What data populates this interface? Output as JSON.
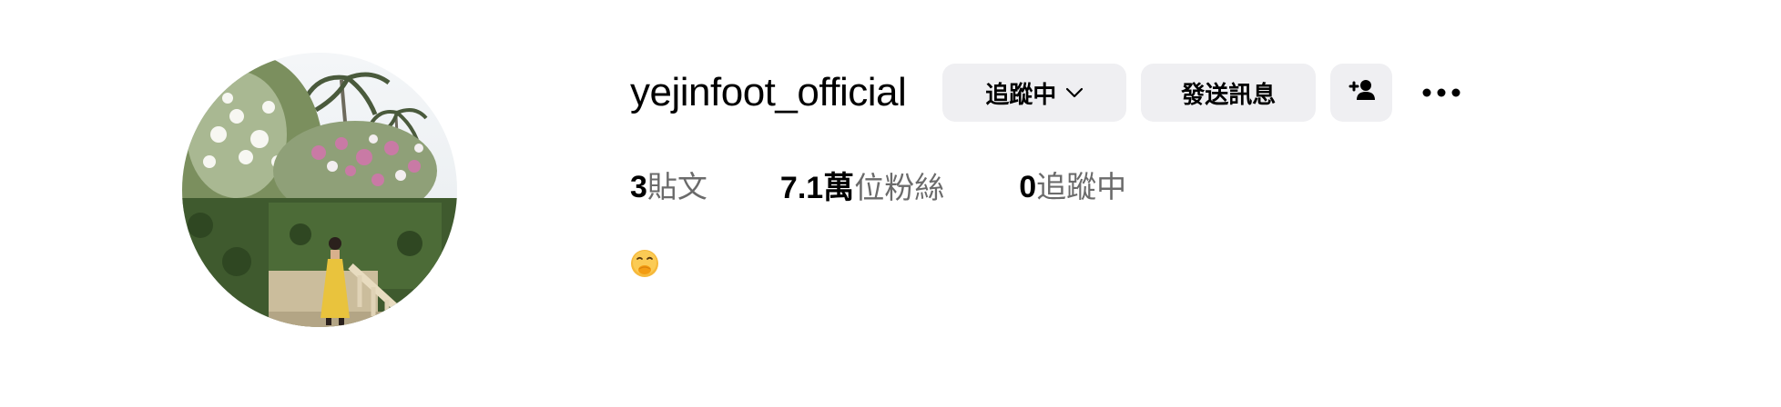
{
  "profile": {
    "username": "yejinfoot_official",
    "buttons": {
      "following_label": "追蹤中",
      "message_label": "發送訊息",
      "suggest_icon": "add-person-icon",
      "more_icon": "more-horizontal-icon"
    },
    "stats": [
      {
        "value": "3",
        "label": "貼文"
      },
      {
        "value": "7.1萬",
        "label": "位粉絲"
      },
      {
        "value": "0",
        "label": "追蹤中"
      }
    ],
    "bio": {
      "emoji_icon": "face-with-hand-over-mouth-emoji"
    }
  },
  "colors": {
    "button_bg": "#efeff2",
    "secondary_text": "#6b6b6b",
    "emoji_yellow": "#f6b93b"
  }
}
